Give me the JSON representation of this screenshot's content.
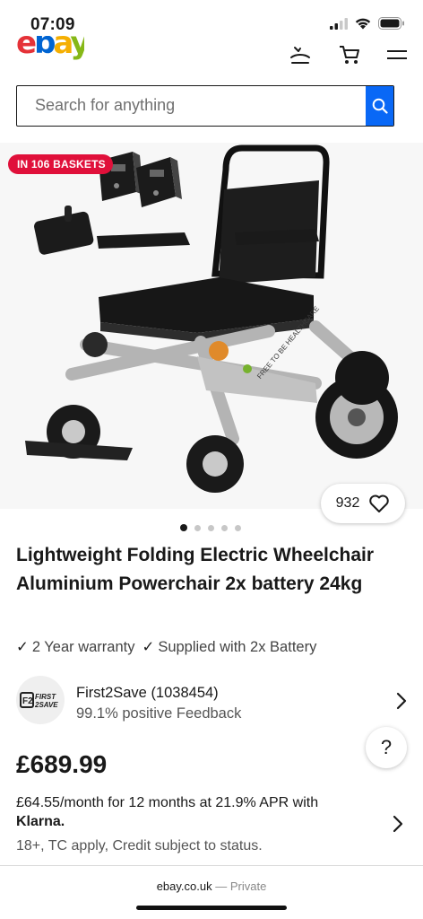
{
  "status": {
    "time": "07:09"
  },
  "header": {
    "logo_text": "ebay"
  },
  "search": {
    "placeholder": "Search for anything"
  },
  "listing": {
    "badge": "IN 106 BASKETS",
    "watch_count": "932",
    "image_count": 5,
    "active_image": 1,
    "title": "Lightweight Folding Electric Wheelchair Aluminium Powerchair 2x battery 24kg",
    "features": [
      "2 Year warranty",
      "Supplied with 2x Battery"
    ],
    "image_label": "FREE TO BE HEALTHCARE"
  },
  "seller": {
    "name": "First2Save (1038454)",
    "feedback": "99.1% positive Feedback",
    "logo_text_1": "FIRST",
    "logo_text_2": "2SAVE"
  },
  "price": {
    "amount": "£689.99",
    "finance_line": "£64.55/month for 12 months at 21.9% APR with",
    "finance_provider": "Klarna.",
    "finance_note": "18+, TC apply, Credit subject to status."
  },
  "help": {
    "label": "?"
  },
  "browser": {
    "domain": "ebay.co.uk",
    "separator": " — ",
    "mode": "Private"
  },
  "colors": {
    "brand_red": "#e53238",
    "brand_blue": "#0064d2",
    "brand_yellow": "#f5af02",
    "brand_green": "#86b817",
    "search_button": "#0968f6",
    "badge": "#e0103a"
  }
}
